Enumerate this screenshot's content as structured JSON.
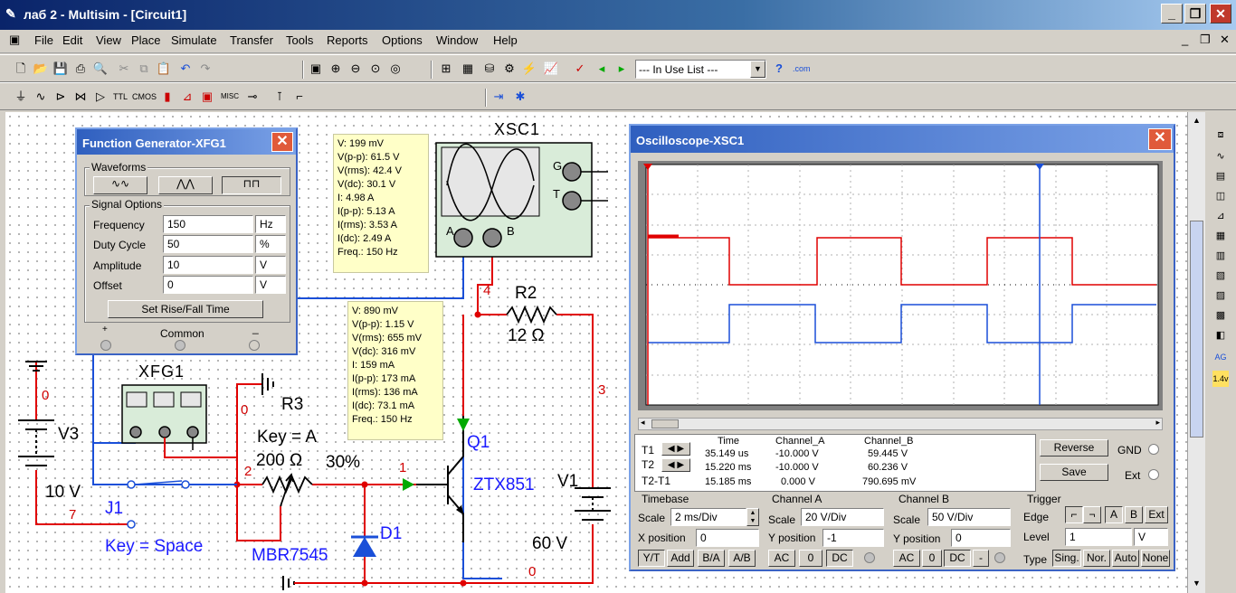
{
  "window": {
    "title": "лаб 2 - Multisim - [Circuit1]"
  },
  "menu": [
    "File",
    "Edit",
    "View",
    "Place",
    "Simulate",
    "Transfer",
    "Tools",
    "Reports",
    "Options",
    "Window",
    "Help"
  ],
  "toolbar": {
    "in_use_list": "--- In Use List ---"
  },
  "function_generator": {
    "title": "Function Generator-XFG1",
    "waveforms_label": "Waveforms",
    "signal_options_label": "Signal Options",
    "fields": [
      {
        "label": "Frequency",
        "value": "150",
        "unit": "Hz"
      },
      {
        "label": "Duty Cycle",
        "value": "50",
        "unit": "%"
      },
      {
        "label": "Amplitude",
        "value": "10",
        "unit": "V"
      },
      {
        "label": "Offset",
        "value": "0",
        "unit": "V"
      }
    ],
    "set_rise_fall": "Set Rise/Fall Time",
    "plus": "+",
    "common": "Common",
    "minus": "_"
  },
  "probe1": [
    "V: 199 mV",
    "V(p-p): 61.5 V",
    "V(rms): 42.4 V",
    "V(dc): 30.1 V",
    "I: 4.98 A",
    "I(p-p): 5.13 A",
    "I(rms): 3.53 A",
    "I(dc): 2.49 A",
    "Freq.: 150 Hz"
  ],
  "probe2": [
    "V: 890 mV",
    "V(p-p): 1.15 V",
    "V(rms): 655 mV",
    "V(dc): 316 mV",
    "I: 159 mA",
    "I(p-p): 173 mA",
    "I(rms): 136 mA",
    "I(dc): 73.1 mA",
    "Freq.: 150 Hz"
  ],
  "circuit": {
    "xsc1": "XSC1",
    "g": "G",
    "t": "T",
    "a": "A",
    "b": "B",
    "xfg1": "XFG1",
    "v3": "V3",
    "v3_val": "10 V",
    "j1": "J1",
    "j1_key": "Key = Space",
    "r3": "R3",
    "r3_key": "Key = A",
    "r3_val": "200 Ω",
    "r3_pct": "30%",
    "r2": "R2",
    "r2_val": "12 Ω",
    "q1": "Q1",
    "q1_model": "ZTX851",
    "v1": "V1",
    "v1_val": "60 V",
    "d1": "D1",
    "d1_model": "MBR7545",
    "nodes": {
      "n0a": "0",
      "n0b": "0",
      "n0c": "0",
      "n1": "1",
      "n2": "2",
      "n3": "3",
      "n4": "4",
      "n7": "7"
    }
  },
  "oscilloscope": {
    "title": "Oscilloscope-XSC1",
    "headers": [
      "Time",
      "Channel_A",
      "Channel_B"
    ],
    "rows": [
      {
        "label": "T1",
        "time": "35.149 us",
        "a": "-10.000 V",
        "b": "59.445 V"
      },
      {
        "label": "T2",
        "time": "15.220 ms",
        "a": "-10.000 V",
        "b": "60.236 V"
      },
      {
        "label": "T2-T1",
        "time": "15.185 ms",
        "a": "0.000 V",
        "b": "790.695 mV"
      }
    ],
    "reverse": "Reverse",
    "save": "Save",
    "gnd": "GND",
    "ext": "Ext",
    "timebase": {
      "label": "Timebase",
      "scale_label": "Scale",
      "scale": "2 ms/Div",
      "xpos_label": "X position",
      "xpos": "0",
      "buttons": [
        "Y/T",
        "Add",
        "B/A",
        "A/B"
      ]
    },
    "channel_a": {
      "label": "Channel A",
      "scale_label": "Scale",
      "scale": "20  V/Div",
      "ypos_label": "Y position",
      "ypos": "-1",
      "buttons": [
        "AC",
        "0",
        "DC"
      ]
    },
    "channel_b": {
      "label": "Channel B",
      "scale_label": "Scale",
      "scale": "50  V/Div",
      "ypos_label": "Y position",
      "ypos": "0",
      "buttons": [
        "AC",
        "0",
        "DC",
        "-"
      ]
    },
    "trigger": {
      "label": "Trigger",
      "edge_label": "Edge",
      "edge_buttons": [
        "A",
        "B",
        "Ext"
      ],
      "level_label": "Level",
      "level": "1",
      "level_unit": "V",
      "type_label": "Type",
      "type_buttons": [
        "Sing.",
        "Nor.",
        "Auto",
        "None"
      ]
    }
  },
  "colors": {
    "wire_red": "#e00000",
    "wire_blue": "#1a4fd8",
    "trace_a": "#e00000",
    "trace_b": "#1a4fd8",
    "title_blue": "#0a246a"
  }
}
